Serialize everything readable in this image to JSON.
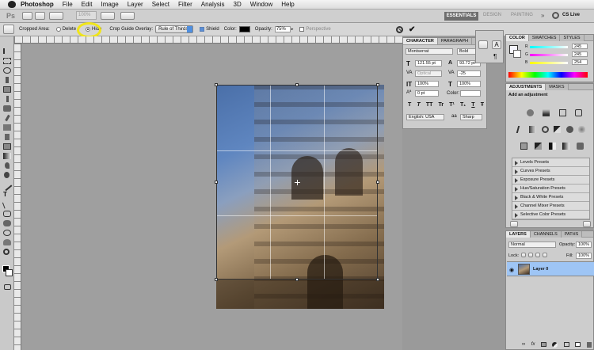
{
  "menubar": {
    "app": "Photoshop",
    "items": [
      "File",
      "Edit",
      "Image",
      "Layer",
      "Select",
      "Filter",
      "Analysis",
      "3D",
      "Window",
      "Help"
    ]
  },
  "appbar": {
    "ps_logo": "Ps",
    "zoom": "100%",
    "workspaces": [
      "ESSENTIALS",
      "DESIGN",
      "PAINTING"
    ],
    "cs_live": "CS Live"
  },
  "options": {
    "cropped_area_label": "Cropped Area:",
    "delete_label": "Delete",
    "hide_label": "Hide",
    "overlay_label": "Crop Guide Overlay:",
    "overlay_value": "Rule of Thirds",
    "shield_label": "Shield",
    "color_label": "Color:",
    "opacity_label": "Opacity:",
    "opacity_value": "75%",
    "perspective_label": "Perspective",
    "cancel_icon": "cancel-icon",
    "commit_icon": "commit-icon"
  },
  "character": {
    "tabs": [
      "CHARACTER",
      "PARAGRAPH"
    ],
    "font_family": "Montserrat",
    "font_style": "Bold",
    "font_size": "121.55 pt",
    "leading": "93.72 pt",
    "kerning": "Optical",
    "tracking": "-25",
    "vscale": "100%",
    "hscale": "100%",
    "baseline": "0 pt",
    "color_label": "Color:",
    "style_buttons": [
      "T",
      "T",
      "TT",
      "Tr",
      "T¹",
      "T₁",
      "T",
      "Ŧ"
    ],
    "language": "English: USA",
    "aa_label": "aa",
    "antialias": "Sharp"
  },
  "color_panel": {
    "tabs": [
      "COLOR",
      "SWATCHES",
      "STYLES"
    ],
    "r": "245",
    "g": "245",
    "b": "254"
  },
  "adjustments": {
    "tabs": [
      "ADJUSTMENTS",
      "MASKS"
    ],
    "subtitle": "Add an adjustment",
    "presets": [
      "Levels Presets",
      "Curves Presets",
      "Exposure Presets",
      "Hue/Saturation Presets",
      "Black & White Presets",
      "Channel Mixer Presets",
      "Selective Color Presets"
    ]
  },
  "layers": {
    "tabs": [
      "LAYERS",
      "CHANNELS",
      "PATHS"
    ],
    "blend_mode": "Normal",
    "opacity_label": "Opacity:",
    "opacity": "100%",
    "lock_label": "Lock:",
    "fill_label": "Fill:",
    "fill": "100%",
    "layer_name": "Layer 0"
  },
  "colors": {
    "accent": "#4f8fe0",
    "highlight": "#f0e519",
    "panel": "#cdcdcd"
  }
}
